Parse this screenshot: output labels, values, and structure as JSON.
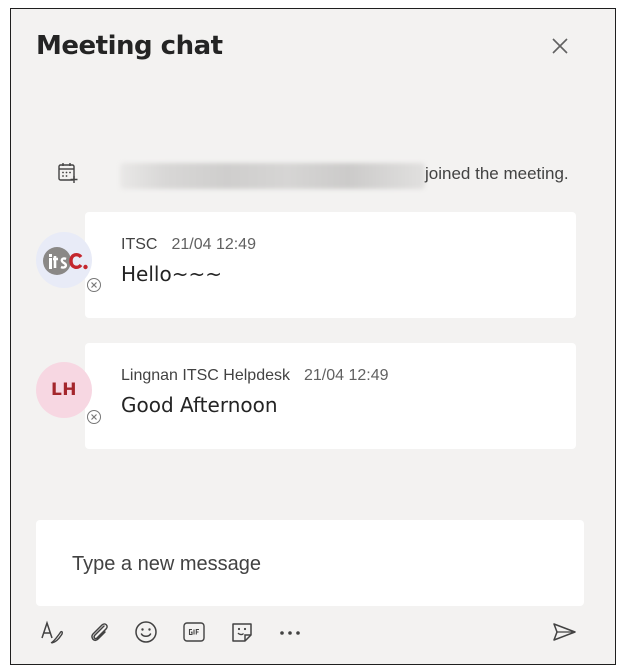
{
  "header": {
    "title": "Meeting chat",
    "close_icon": "close-icon"
  },
  "system_event": {
    "icon": "meeting-calendar-icon",
    "text": "joined the meeting."
  },
  "messages": [
    {
      "avatar_type": "itsc-logo",
      "sender": "ITSC",
      "time": "21/04 12:49",
      "text": "Hello~~~"
    },
    {
      "avatar_initials": "LH",
      "sender": "Lingnan ITSC Helpdesk",
      "time": "21/04 12:49",
      "text": "Good Afternoon"
    }
  ],
  "compose": {
    "placeholder": "Type a new message"
  },
  "toolbar": {
    "icons": [
      "format-icon",
      "attach-icon",
      "emoji-icon",
      "gif-icon",
      "sticker-icon",
      "more-options-icon",
      "send-icon"
    ]
  },
  "colors": {
    "panel_bg": "#f3f2f1",
    "card_bg": "#ffffff",
    "lh_avatar_bg": "#f7d7e2",
    "lh_initials": "#a4262c",
    "itsc_red": "#c4262e"
  }
}
